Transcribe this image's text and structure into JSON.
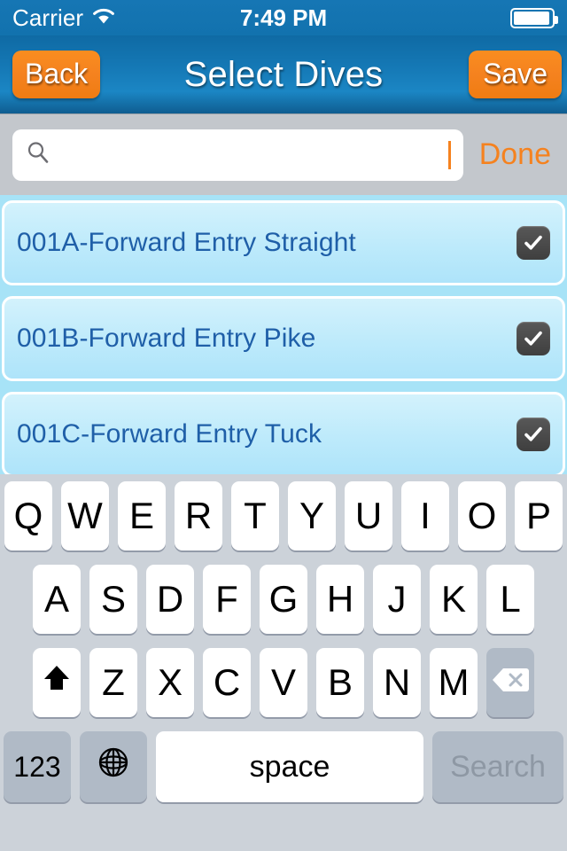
{
  "status_bar": {
    "carrier": "Carrier",
    "wifi_icon": "wifi-icon",
    "time": "7:49 PM",
    "battery_icon": "battery-icon"
  },
  "nav_bar": {
    "back_label": "Back",
    "title": "Select Dives",
    "save_label": "Save"
  },
  "search": {
    "icon": "search-icon",
    "value": "",
    "placeholder": "",
    "done_label": "Done"
  },
  "list": {
    "rows": [
      {
        "label": "001A-Forward Entry Straight",
        "checked": true
      },
      {
        "label": "001B-Forward Entry Pike",
        "checked": true
      },
      {
        "label": "001C-Forward Entry Tuck",
        "checked": true
      }
    ]
  },
  "keyboard": {
    "row1": [
      "Q",
      "W",
      "E",
      "R",
      "T",
      "Y",
      "U",
      "I",
      "O",
      "P"
    ],
    "row2": [
      "A",
      "S",
      "D",
      "F",
      "G",
      "H",
      "J",
      "K",
      "L"
    ],
    "row3": [
      "Z",
      "X",
      "C",
      "V",
      "B",
      "N",
      "M"
    ],
    "shift_icon": "shift-arrow-icon",
    "backspace_icon": "backspace-icon",
    "numeric_label": "123",
    "globe_icon": "globe-icon",
    "space_label": "space",
    "search_label": "Search"
  },
  "colors": {
    "nav_blue": "#1579b6",
    "accent_orange": "#f5821f",
    "row_cyan": "#bdeafb",
    "row_text_blue": "#1f5fa8",
    "keyboard_bg": "#ccd2d9"
  }
}
